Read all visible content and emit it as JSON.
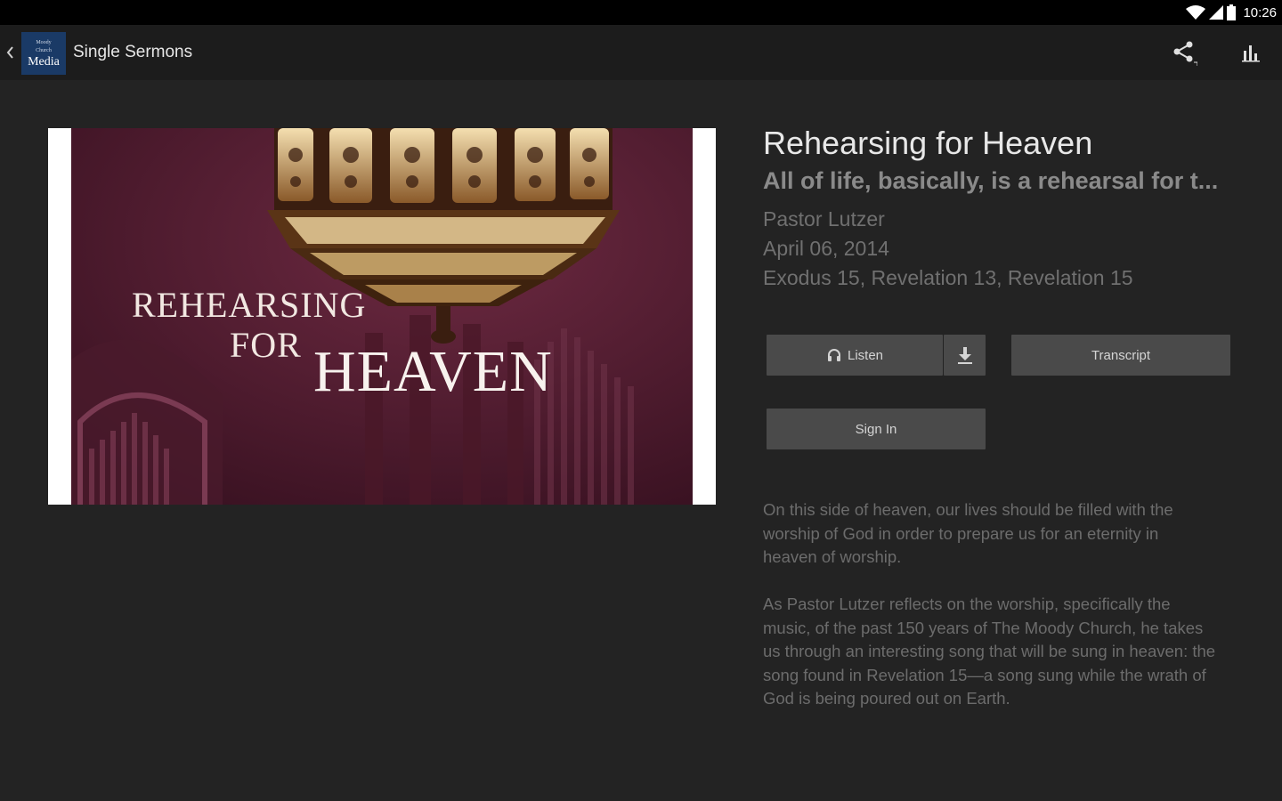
{
  "status_bar": {
    "time": "10:26"
  },
  "action_bar": {
    "logo_text_top": "Moody",
    "logo_text_mid": "Church",
    "logo_text_bottom": "Media",
    "title": "Single Sermons"
  },
  "artwork": {
    "line1": "REHEARSING",
    "line2": "FOR",
    "line3": "HEAVEN"
  },
  "sermon": {
    "title": "Rehearsing for Heaven",
    "subtitle": "All of life, basically, is a rehearsal for t...",
    "speaker": "Pastor Lutzer",
    "date": "April 06, 2014",
    "references": "Exodus 15, Revelation 13, Revelation 15"
  },
  "buttons": {
    "listen": "Listen",
    "transcript": "Transcript",
    "sign_in": "Sign In"
  },
  "description": {
    "p1": "On this side of heaven, our lives should be filled with the worship of God in order to prepare us for an eternity in heaven of worship.",
    "p2": "As Pastor Lutzer reflects on the worship, specifically the music, of the past 150 years of The Moody Church, he takes us through an interesting song that will be sung in heaven: the song found in Revelation 15—a song sung while the wrath of God is being poured out on Earth."
  },
  "icons": [
    "wifi-icon",
    "signal-icon",
    "battery-icon",
    "back-chevron-icon",
    "share-icon",
    "stats-icon",
    "headphones-icon",
    "download-icon"
  ],
  "colors": {
    "background": "#232323",
    "action_bar": "#1c1c1c",
    "button": "#4a4a4a",
    "artwork_tint": "#5a1f33"
  }
}
